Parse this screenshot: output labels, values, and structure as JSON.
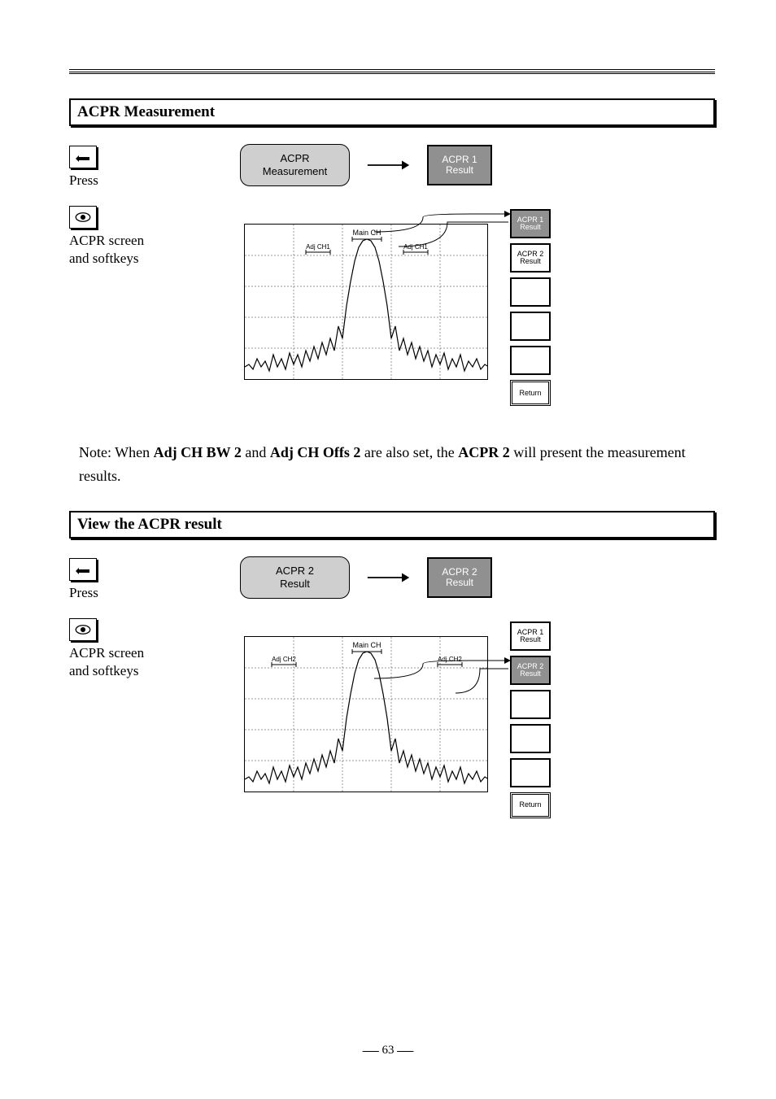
{
  "section1": {
    "title": "ACPR Measurement",
    "row1": {
      "left": "Press",
      "button_l1": "ACPR",
      "button_l2": "Measurement",
      "result_l1": "ACPR 1",
      "result_l2": "Result"
    },
    "row2": {
      "left_l1": "ACPR screen",
      "left_l2": "and softkeys",
      "side1": "ACPR 1\nResult",
      "side2": "ACPR 2\nResult",
      "side3": "",
      "side4": "",
      "side5": "",
      "side6": "Return"
    }
  },
  "note": {
    "prefix": "Note: When ",
    "b1": "Adj CH BW 2",
    "mid1": " and ",
    "b2": "Adj CH Offs 2",
    "mid2": " are also set, the ",
    "b3": "ACPR 2",
    "suffix": " will present the measurement results."
  },
  "section2": {
    "title": "View the ACPR result",
    "row1": {
      "left": "Press",
      "button_l1": "ACPR 2",
      "button_l2": "Result",
      "result_l1": "ACPR 2",
      "result_l2": "Result"
    },
    "row2": {
      "left_l1": "ACPR screen",
      "left_l2": "and softkeys",
      "side1": "ACPR 1\nResult",
      "side2": "ACPR 2\nResult",
      "side3": "",
      "side4": "",
      "side5": "",
      "side6": "Return"
    }
  },
  "screen_labels": {
    "mainch": "Main CH",
    "adjch1": "Adj CH1",
    "adjch1_r": "Adj CH1",
    "adjch2": "Adj CH2",
    "adjch2_r": "Adj CH2"
  },
  "page_num": "63"
}
